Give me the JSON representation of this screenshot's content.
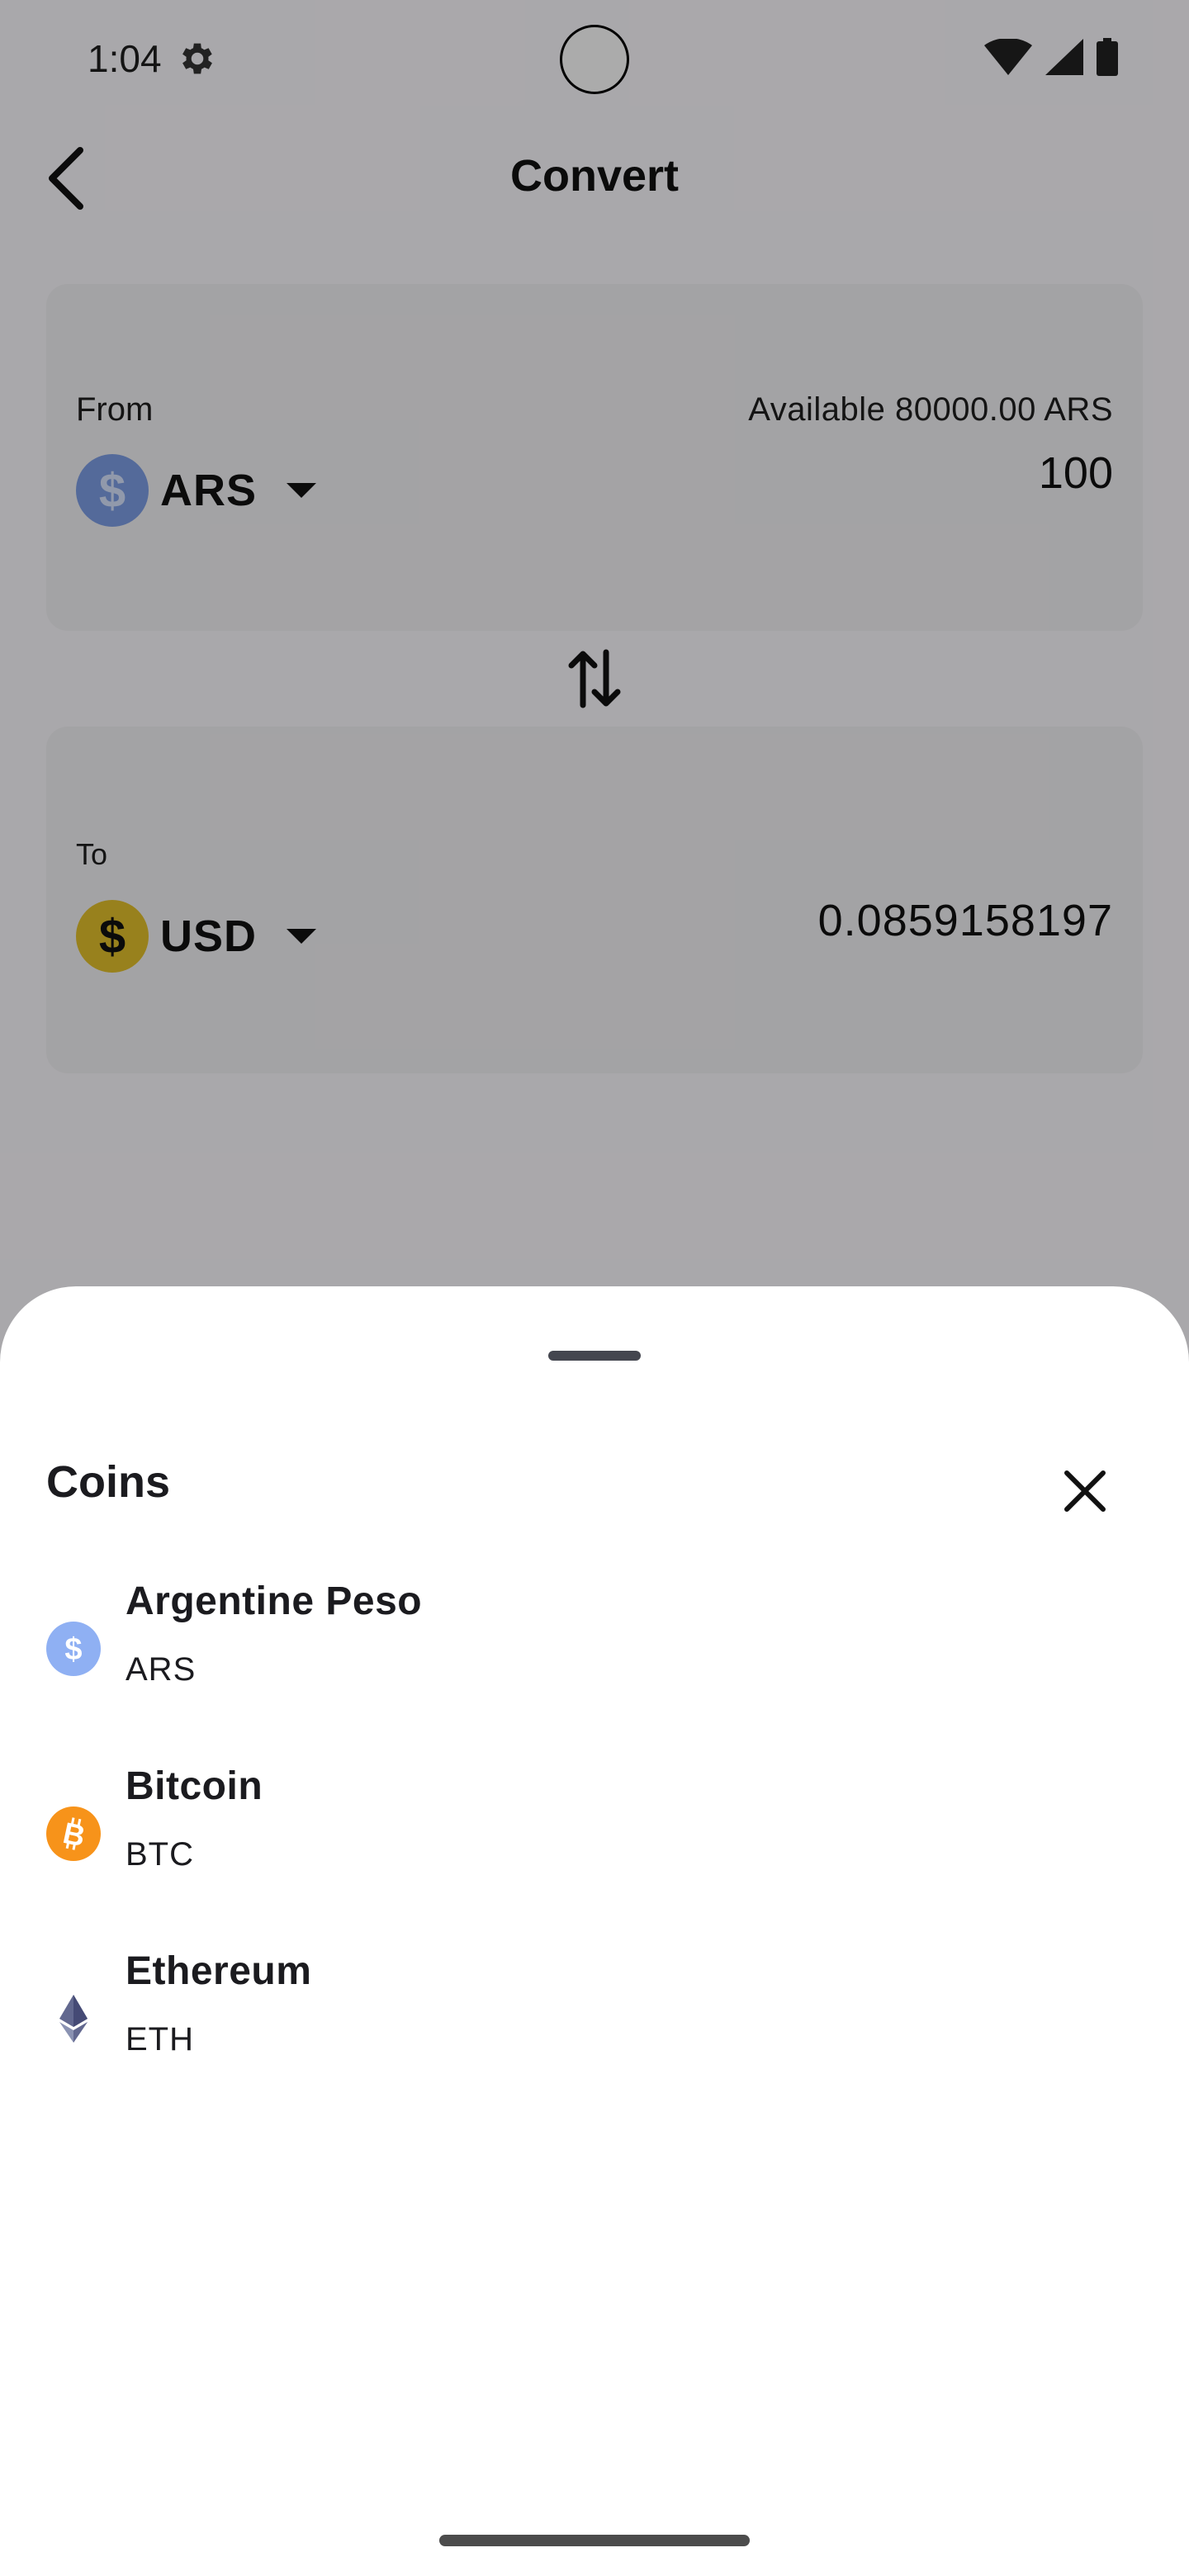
{
  "status_bar": {
    "time": "1:04",
    "icons": [
      "gear-icon",
      "wifi-icon",
      "cellular-signal-icon",
      "battery-icon"
    ]
  },
  "app_bar": {
    "title": "Convert",
    "back_icon": "arrow-back-icon"
  },
  "from_card": {
    "label": "From",
    "available": "Available 80000.00 ARS",
    "coin_symbol_glyph": "$",
    "coin_code": "ARS",
    "amount": "100",
    "coin_color": "#7e9fe6"
  },
  "swap_icon": "swap-vertical-icon",
  "to_card": {
    "label": "To",
    "coin_symbol_glyph": "$",
    "coin_code": "USD",
    "amount": "0.0859158197",
    "coin_color": "#e3c02c"
  },
  "sheet": {
    "title": "Coins",
    "close_icon": "close-icon",
    "items": [
      {
        "name": "Argentine Peso",
        "symbol": "ARS",
        "icon": "peso-coin-icon",
        "color": "#8fb0f3"
      },
      {
        "name": "Bitcoin",
        "symbol": "BTC",
        "icon": "bitcoin-icon",
        "color": "#f7931a"
      },
      {
        "name": "Ethereum",
        "symbol": "ETH",
        "icon": "ethereum-icon",
        "color": "#62688f"
      }
    ]
  }
}
